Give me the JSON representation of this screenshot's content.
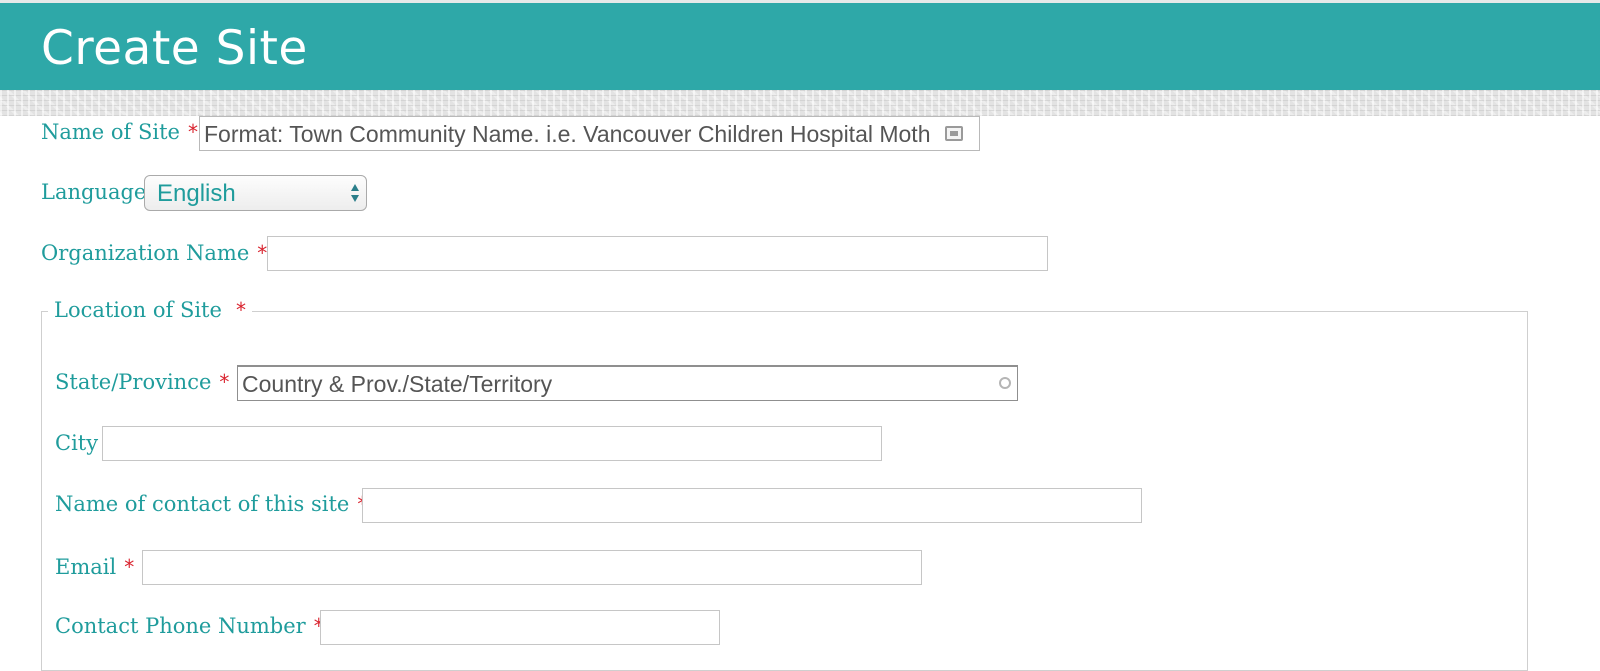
{
  "header": {
    "title": "Create Site"
  },
  "form": {
    "name_of_site": {
      "label": "Name of Site",
      "required_mark": "*",
      "placeholder": "Format: Town Community Name. i.e. Vancouver Children Hospital Moth",
      "value": ""
    },
    "language": {
      "label": "Language",
      "selected": "English"
    },
    "organization_name": {
      "label": "Organization Name",
      "required_mark": "*",
      "value": ""
    },
    "location": {
      "legend": "Location of Site",
      "required_mark": "*",
      "state_province": {
        "label": "State/Province",
        "required_mark": "*",
        "placeholder": "Country & Prov./State/Territory"
      },
      "city": {
        "label": "City",
        "value": ""
      },
      "contact_name": {
        "label": "Name of contact of this site",
        "required_mark": "*",
        "value": ""
      },
      "email": {
        "label": "Email",
        "required_mark": "*",
        "value": ""
      },
      "phone": {
        "label": "Contact Phone Number",
        "required_mark": "*",
        "value": ""
      }
    }
  },
  "colors": {
    "header_bg": "#2ea8a8",
    "label_text": "#1f9c9c",
    "required": "#d9232e"
  }
}
